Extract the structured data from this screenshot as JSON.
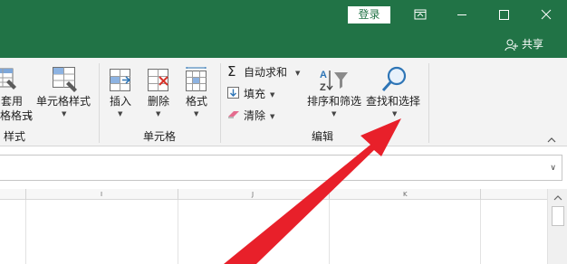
{
  "titlebar": {
    "login_label": "登录",
    "share_label": "共享"
  },
  "ribbon": {
    "styles_group": {
      "cut_label_top": "套用",
      "cut_label_bottom": "表格格式",
      "cell_style_label": "单元格样式",
      "group_label": "样式"
    },
    "cells_group": {
      "insert_label": "插入",
      "delete_label": "删除",
      "format_label": "格式",
      "group_label": "单元格"
    },
    "editing_group": {
      "autosum_label": "自动求和",
      "fill_label": "填充",
      "clear_label": "清除",
      "sort_filter_label": "排序和筛选",
      "find_select_label": "查找和选择",
      "group_label": "编辑"
    }
  },
  "grid": {
    "columns": [
      "I",
      "J",
      "K"
    ]
  },
  "colors": {
    "brand": "#217346",
    "annotation_arrow": "#e8202a"
  }
}
